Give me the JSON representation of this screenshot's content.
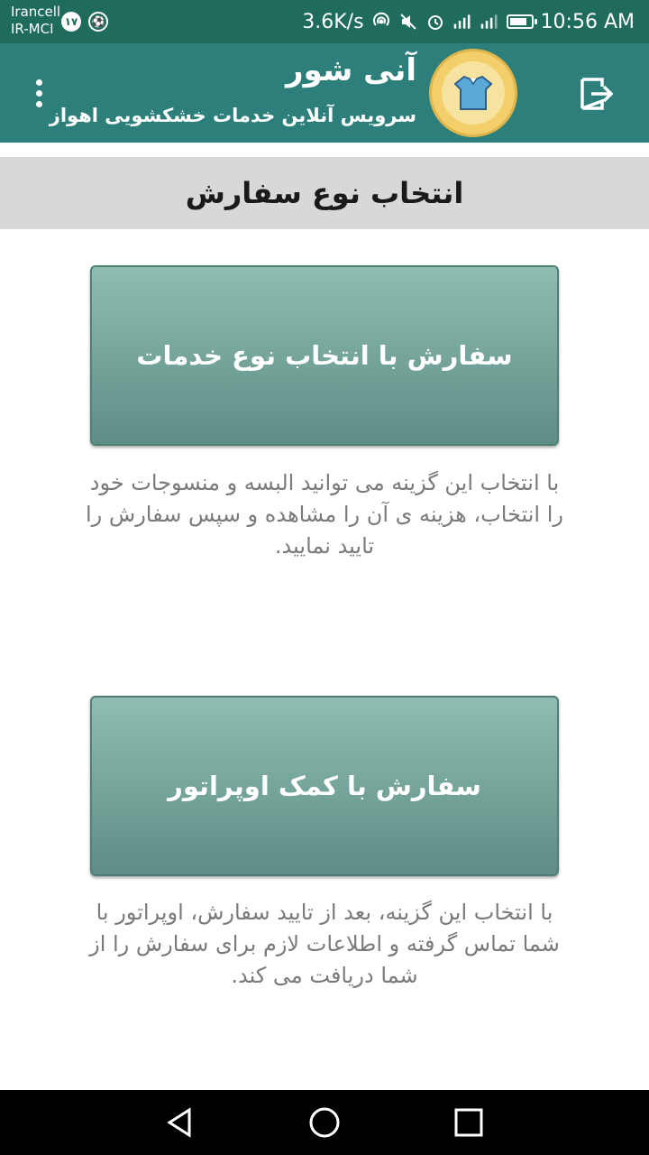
{
  "status_bar": {
    "carrier_line1": "Irancell",
    "carrier_line2": "IR-MCI",
    "badge_text": "۱۷",
    "net_speed": "3.6K/s",
    "time": "10:56 AM",
    "battery_level": 0.7,
    "icons": [
      "hotspot-icon",
      "mute-icon",
      "alarm-icon",
      "signal-4g-icon",
      "signal-2g-icon",
      "battery-icon"
    ]
  },
  "app_bar": {
    "title": "آنی شور",
    "subtitle": "سرویس آنلاین خدمات خشکشویی اهواز",
    "icons": [
      "more-vert-icon",
      "logo",
      "logout-icon"
    ]
  },
  "section": {
    "title": "انتخاب نوع سفارش"
  },
  "options": [
    {
      "label": "سفارش با انتخاب نوع خدمات",
      "description": "با انتخاب این گزینه می توانید البسه و منسوجات خود را انتخاب، هزینه ی آن را مشاهده و سپس سفارش را تایید نمایید."
    },
    {
      "label": "سفارش با کمک اوپراتور",
      "description": "با انتخاب این گزینه، بعد از تایید سفارش، اوپراتور با شما تماس گرفته و اطلاعات لازم برای سفارش را از شما دریافت می کند."
    }
  ],
  "colors": {
    "status_bar": "#1f6b5c",
    "app_bar": "#2d7f7c",
    "section_bg": "#d8d8d8",
    "button_top": "#8fbdb4",
    "button_bottom": "#5d8d84"
  }
}
